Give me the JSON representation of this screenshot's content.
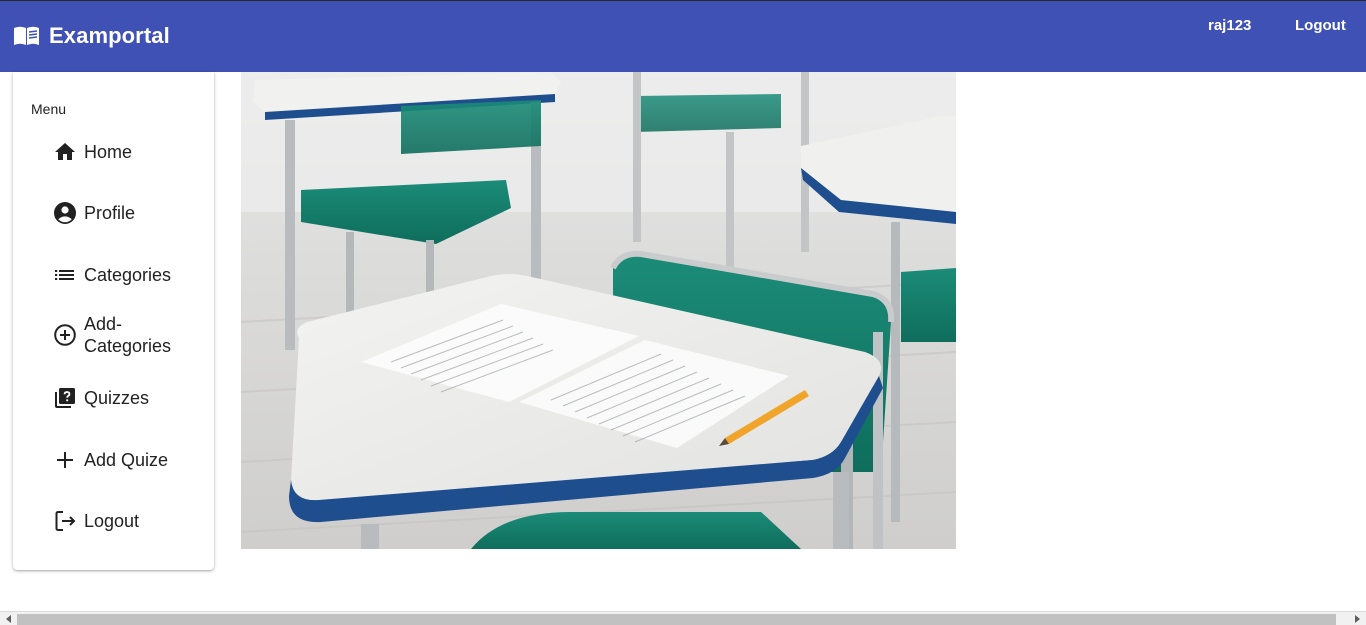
{
  "header": {
    "brand_icon": "open-book-icon",
    "title": "Examportal",
    "username": "raj123",
    "logout_label": "Logout",
    "background_color": "#3f51b5"
  },
  "sidebar": {
    "menu_header": "Menu",
    "items": [
      {
        "label": "Home",
        "icon": "home-icon"
      },
      {
        "label": "Profile",
        "icon": "account-circle-icon"
      },
      {
        "label": "Categories",
        "icon": "list-icon"
      },
      {
        "label": "Add-Categories",
        "icon": "add-circle-outline-icon"
      },
      {
        "label": "Quizzes",
        "icon": "quiz-icon"
      },
      {
        "label": "Add Quize",
        "icon": "plus-icon"
      },
      {
        "label": "Logout",
        "icon": "logout-icon"
      }
    ]
  },
  "main": {
    "hero_image": "classroom-desks-exam-sheet-photo"
  },
  "scrollbar": {
    "orientation": "horizontal",
    "left_arrow_icon": "scroll-left-arrow-icon",
    "right_arrow_icon": "scroll-right-arrow-icon"
  }
}
